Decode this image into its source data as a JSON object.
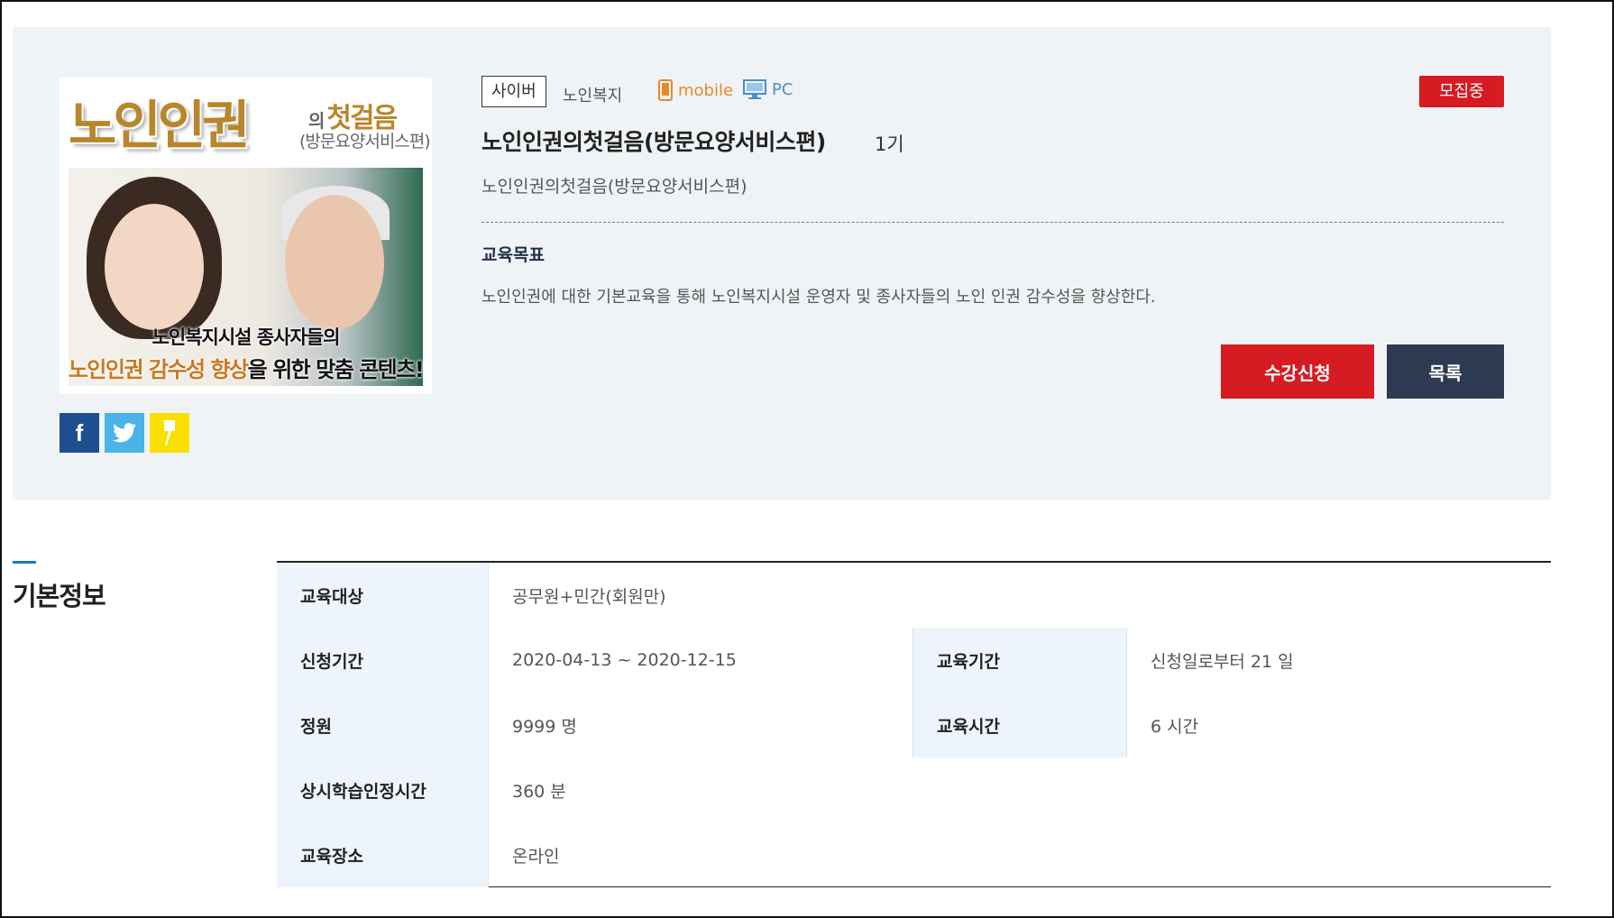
{
  "course": {
    "thumbnail": {
      "title_main": "노인인권",
      "title_particle": "의",
      "title_sub1": "첫걸음",
      "title_sub2": "(방문요양서비스편)",
      "caption_line1": "노인복지시설 종사자들의",
      "caption_highlight": "노인인권 감수성 향상",
      "caption_rest": "을 위한 맞춤 콘텐츠!"
    },
    "tag": "사이버",
    "category": "노인복지",
    "devices": {
      "mobile": "mobile",
      "pc": "PC"
    },
    "status": "모집중",
    "title": "노인인권의첫걸음(방문요양서비스편)",
    "generation": "1기",
    "description": "노인인권의첫걸음(방문요양서비스편)",
    "goal_title": "교육목표",
    "goal_text": "노인인권에 대한 기본교육을 통해 노인복지시설 운영자 및 종사자들의 노인 인권 감수성을 향상한다.",
    "apply_label": "수강신청",
    "list_label": "목록"
  },
  "share": {
    "facebook": "f"
  },
  "info": {
    "section_title": "기본정보",
    "target_label": "교육대상",
    "target_value": "공무원+민간(회원만)",
    "apply_period_label": "신청기간",
    "apply_period_value": "2020-04-13 ~ 2020-12-15",
    "edu_period_label": "교육기간",
    "edu_period_value": "신청일로부터 21 일",
    "capacity_label": "정원",
    "capacity_value": "9999 명",
    "edu_time_label": "교육시간",
    "edu_time_value": "6 시간",
    "learning_time_label": "상시학습인정시간",
    "learning_time_value": "360 분",
    "location_label": "교육장소",
    "location_value": "온라인"
  },
  "colors": {
    "accent_red": "#d61b22",
    "navy": "#2e3a52",
    "table_header": "#eef4fb",
    "section_bar": "#1b78c8"
  }
}
